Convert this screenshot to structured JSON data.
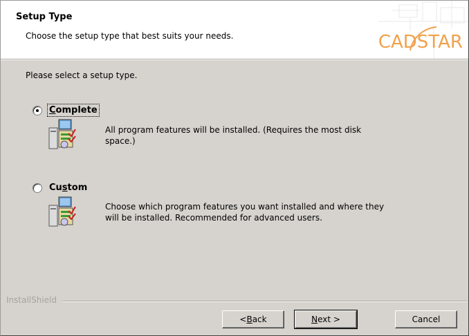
{
  "header": {
    "title": "Setup Type",
    "subtitle": "Choose the setup type that best suits your needs.",
    "logo_text": "CADSTAR"
  },
  "prompt": "Please select a setup type.",
  "options": [
    {
      "label_pre": "",
      "label_u": "C",
      "label_post": "omplete",
      "selected": true,
      "description": "All program features will be installed. (Requires the most disk space.)",
      "desc_line1": "All program features will be installed. (Requires the most disk",
      "desc_line2": "space.)",
      "icon": "setup-computer-icon"
    },
    {
      "label_pre": "Cu",
      "label_u": "s",
      "label_post": "tom",
      "selected": false,
      "desc_line1": "Choose which program features you want installed and where they",
      "desc_line2": "will be installed. Recommended for advanced users.",
      "icon": "setup-computer-icon"
    }
  ],
  "footer": {
    "brand": "InstallShield",
    "back_pre": "< ",
    "back_u": "B",
    "back_post": "ack",
    "next_u": "N",
    "next_post": "ext >",
    "cancel": "Cancel"
  },
  "colors": {
    "dialog_bg": "#d6d3ce",
    "header_bg": "#ffffff",
    "logo": "#f0a24c"
  }
}
